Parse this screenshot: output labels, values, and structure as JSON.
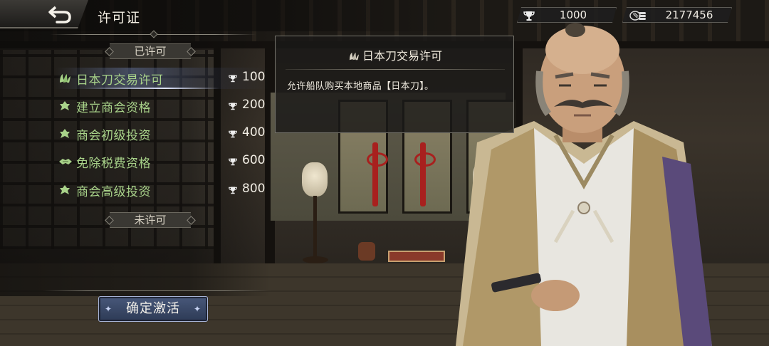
{
  "header": {
    "title": "许可证",
    "back_icon": "back-arrow-icon"
  },
  "resources": {
    "reputation": {
      "icon": "trophy-icon",
      "value": "1000"
    },
    "silver": {
      "icon": "silver-coins-icon",
      "value": "2177456"
    }
  },
  "sections": {
    "licensed": "已许可",
    "unlicensed": "未许可"
  },
  "permits": [
    {
      "label": "日本刀交易许可",
      "icon": "sword-leaf-icon",
      "cost": "100",
      "selected": true
    },
    {
      "label": "建立商会资格",
      "icon": "guild-leaf-icon",
      "cost": "200",
      "selected": false
    },
    {
      "label": "商会初级投资",
      "icon": "investment-leaf-icon",
      "cost": "400",
      "selected": false
    },
    {
      "label": "免除税费资格",
      "icon": "handshake-icon",
      "cost": "600",
      "selected": false
    },
    {
      "label": "商会高级投资",
      "icon": "investment-leaf-icon",
      "cost": "800",
      "selected": false
    }
  ],
  "detail": {
    "title": "日本刀交易许可",
    "description": "允许船队购买本地商品【日本刀】。"
  },
  "actions": {
    "confirm_label": "确定激活"
  },
  "colors": {
    "permit_text": "#a9d38a",
    "accent_button": "#2d3a55",
    "highlight_row": "#5f6e96"
  }
}
